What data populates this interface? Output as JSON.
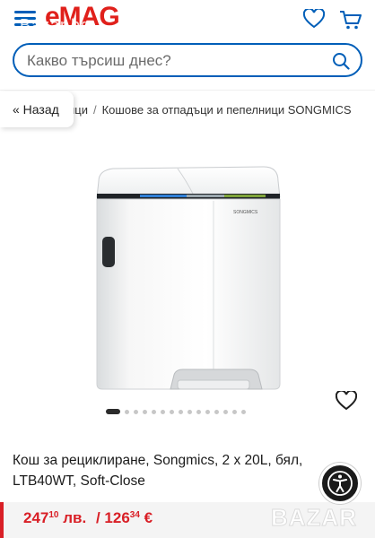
{
  "header": {
    "logo_text": "eMAG",
    "logo_overlay": "Bazar.bg"
  },
  "search": {
    "placeholder": "Какво търсиш днес?"
  },
  "breadcrumb": {
    "back_label": "« Назад",
    "items": [
      "ици",
      "Кошове за отпадъци и пепелници SONGMICS"
    ],
    "separator": "/"
  },
  "gallery": {
    "total_images": 15,
    "active_index": 0,
    "lid_stripe_colors": [
      "#2f7fd6",
      "#9aa6ad",
      "#7ea33a"
    ]
  },
  "product": {
    "title": "Кош за рециклиране, Songmics, 2 x 20L, бял, LTB40WT, Soft-Close",
    "brand_label": "SONGMICS"
  },
  "price": {
    "current_main": "247",
    "current_cents": "10",
    "current_currency": "лв.",
    "separator": "/",
    "alt_main": "126",
    "alt_cents": "34",
    "alt_currency": "€",
    "color": "#d91f26"
  },
  "watermark": "BAZAR",
  "colors": {
    "brand_blue": "#005eb8",
    "brand_red": "#e0201b"
  }
}
